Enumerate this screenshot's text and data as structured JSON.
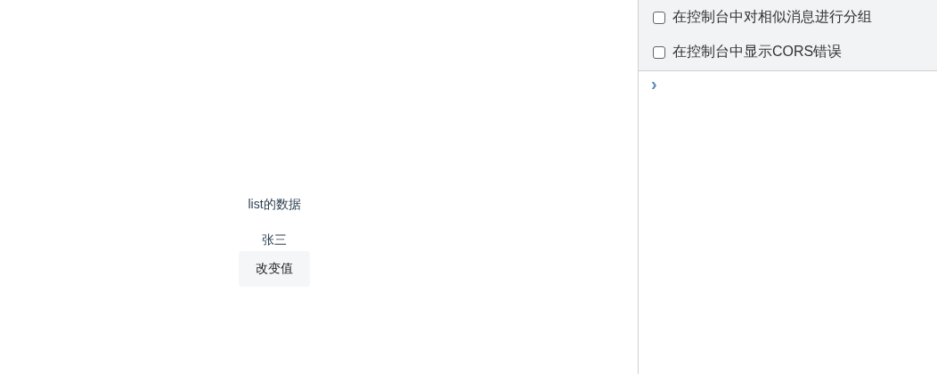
{
  "page": {
    "heading": "list的数据",
    "items": [
      "张三"
    ],
    "button": "改变值"
  },
  "console": {
    "settings": [
      {
        "label": "在控制台中对相似消息进行分组",
        "checked": false
      },
      {
        "label": "在控制台中显示CORS错误",
        "checked": false
      }
    ],
    "prompt": "›"
  }
}
